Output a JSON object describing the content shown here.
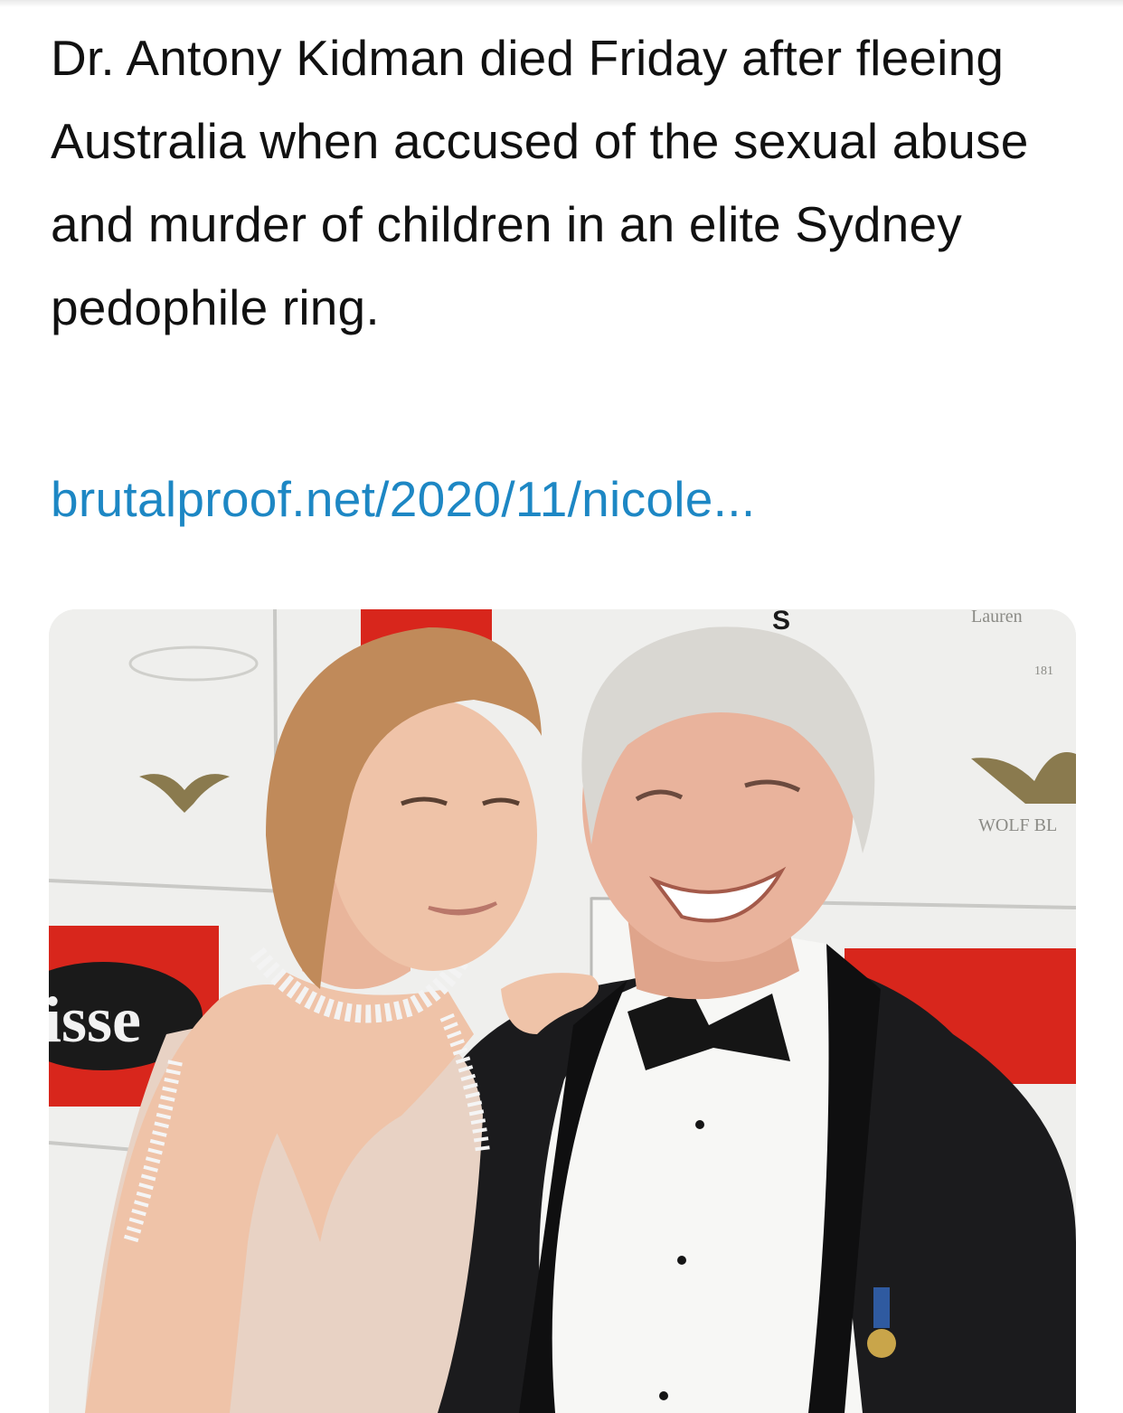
{
  "tweet": {
    "text": "Dr. Antony Kidman died Friday after fleeing Australia when accused of the sexual abuse and murder of children in an elite Sydney pedophile ring.",
    "link_text": "brutalproof.net/2020/11/nicole..."
  },
  "photo": {
    "backdrop_texts": [
      "isse",
      "WOLF BL",
      "Lauren",
      "181",
      "S"
    ],
    "colors": {
      "backdrop": "#efefed",
      "panel_red": "#d8261c",
      "tuxedo": "#1b1b1d",
      "shirt": "#f7f7f5",
      "skin": "#e9b39c",
      "hair_woman": "#c08a5a",
      "hair_man": "#d9d7d2"
    }
  }
}
